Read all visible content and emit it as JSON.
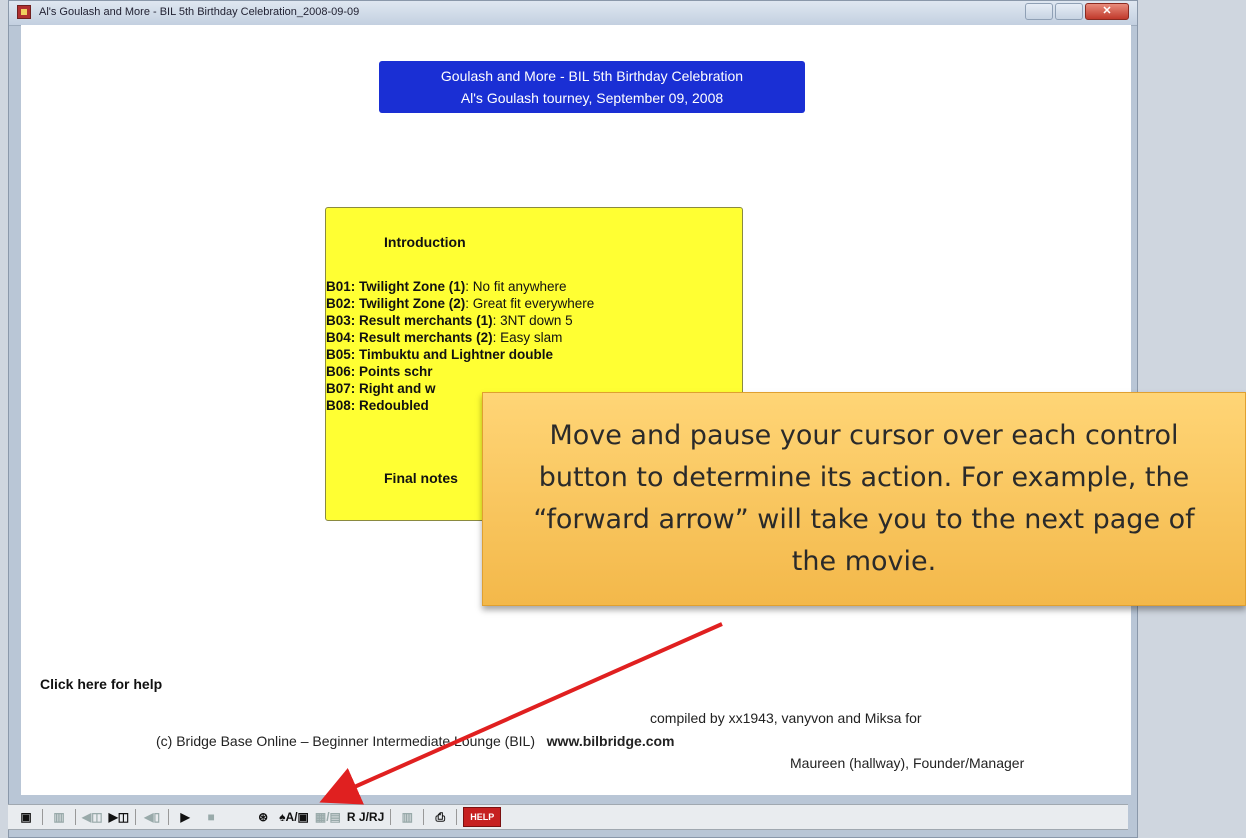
{
  "window": {
    "title": "Al's Goulash and More - BIL 5th Birthday Celebration_2008-09-09"
  },
  "header": {
    "line1": "Goulash and More - BIL 5th Birthday Celebration",
    "line2": "Al's Goulash tourney, September 09, 2008"
  },
  "menu": {
    "intro": "Introduction",
    "items": [
      {
        "code": "B01:",
        "title": "Twilight Zone (1)",
        "desc": ": No fit anywhere"
      },
      {
        "code": "B02:",
        "title": "Twilight Zone (2)",
        "desc": ": Great fit everywhere"
      },
      {
        "code": "B03:",
        "title": "Result merchants (1)",
        "desc": ": 3NT down 5"
      },
      {
        "code": "B04:",
        "title": "Result merchants (2)",
        "desc": ": Easy slam"
      },
      {
        "code": "B05:",
        "title": "Timbuktu and Lightner double",
        "desc": ""
      },
      {
        "code": "B06:",
        "title": "Points schr",
        "desc": ""
      },
      {
        "code": "B07:",
        "title": "Right and w",
        "desc": ""
      },
      {
        "code": "B08:",
        "title": "Redoubled",
        "desc": ""
      }
    ],
    "final": "Final notes"
  },
  "help_link": "Click here for help",
  "credits": {
    "line1": "compiled by xx1943, vanyvon and Miksa for",
    "line2_prefix": "(c) Bridge Base Online – Beginner Intermediate Lounge (BIL)",
    "line2_url": "www.bilbridge.com",
    "line3": "Maureen (hallway), Founder/Manager"
  },
  "callout": {
    "text": "Move and pause your cursor over each control button to determine its action.  For example, the “forward arrow” will take you to the next page of the movie."
  },
  "toolbar": {
    "icons": [
      "save-icon",
      "blank-icon",
      "back-to-start-icon",
      "play-from-start-icon",
      "step-back-icon",
      "forward-arrow-icon",
      "stop-icon",
      "view-icon",
      "ar-icon",
      "ar2-icon",
      "blank2-icon",
      "print-icon",
      "help-icon"
    ],
    "labels": {
      "save": "▣",
      "blank": "▥",
      "back_start": "◀◫",
      "play_start": "▶◫",
      "step_back": "◀▯",
      "forward": "▶",
      "stop": "■",
      "view": "⊛",
      "ar": "♠A/▣",
      "ar2": "▦/▤",
      "rj": "R J/RJ",
      "blank2": "▥",
      "print": "⎙",
      "help": "HELP"
    }
  },
  "colors": {
    "header_bg": "#1a2fd4",
    "menu_bg": "#ffff33",
    "callout_bg": "#f3b84a",
    "arrow": "#e02020"
  }
}
